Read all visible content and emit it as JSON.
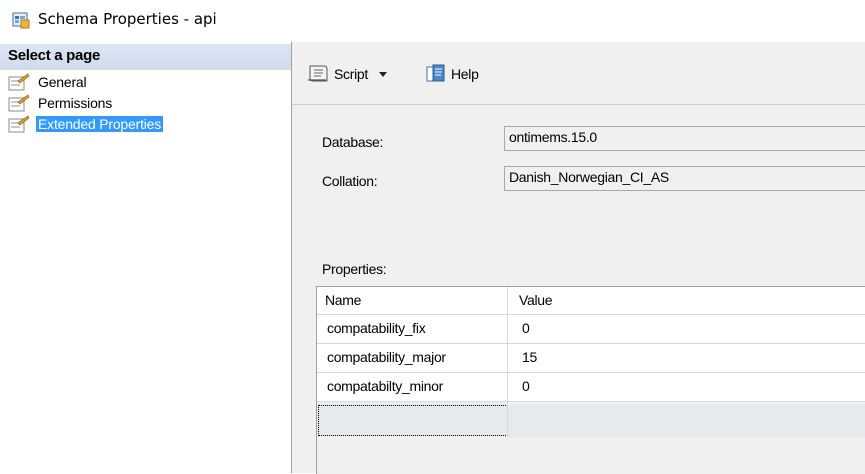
{
  "window": {
    "title": "Schema Properties - api",
    "icon": "schema-properties-icon"
  },
  "sidebar": {
    "header": "Select a page",
    "items": [
      {
        "label": "General",
        "icon": "page-icon",
        "selected": false
      },
      {
        "label": "Permissions",
        "icon": "page-icon",
        "selected": false
      },
      {
        "label": "Extended Properties",
        "icon": "page-icon",
        "selected": true
      }
    ]
  },
  "toolbar": {
    "script_label": "Script",
    "help_label": "Help"
  },
  "form": {
    "database_label": "Database:",
    "database_value": "ontimems.15.0",
    "collation_label": "Collation:",
    "collation_value": "Danish_Norwegian_CI_AS",
    "properties_label": "Properties:"
  },
  "grid": {
    "columns": [
      "Name",
      "Value"
    ],
    "rows": [
      {
        "name": "compatability_fix",
        "value": "0"
      },
      {
        "name": "compatability_major",
        "value": "15"
      },
      {
        "name": "compatabilty_minor",
        "value": "0"
      }
    ]
  },
  "colors": {
    "selection": "#3399ff",
    "panel_bg": "#f0f0f0",
    "header_gradient": "#d6e1f0"
  }
}
